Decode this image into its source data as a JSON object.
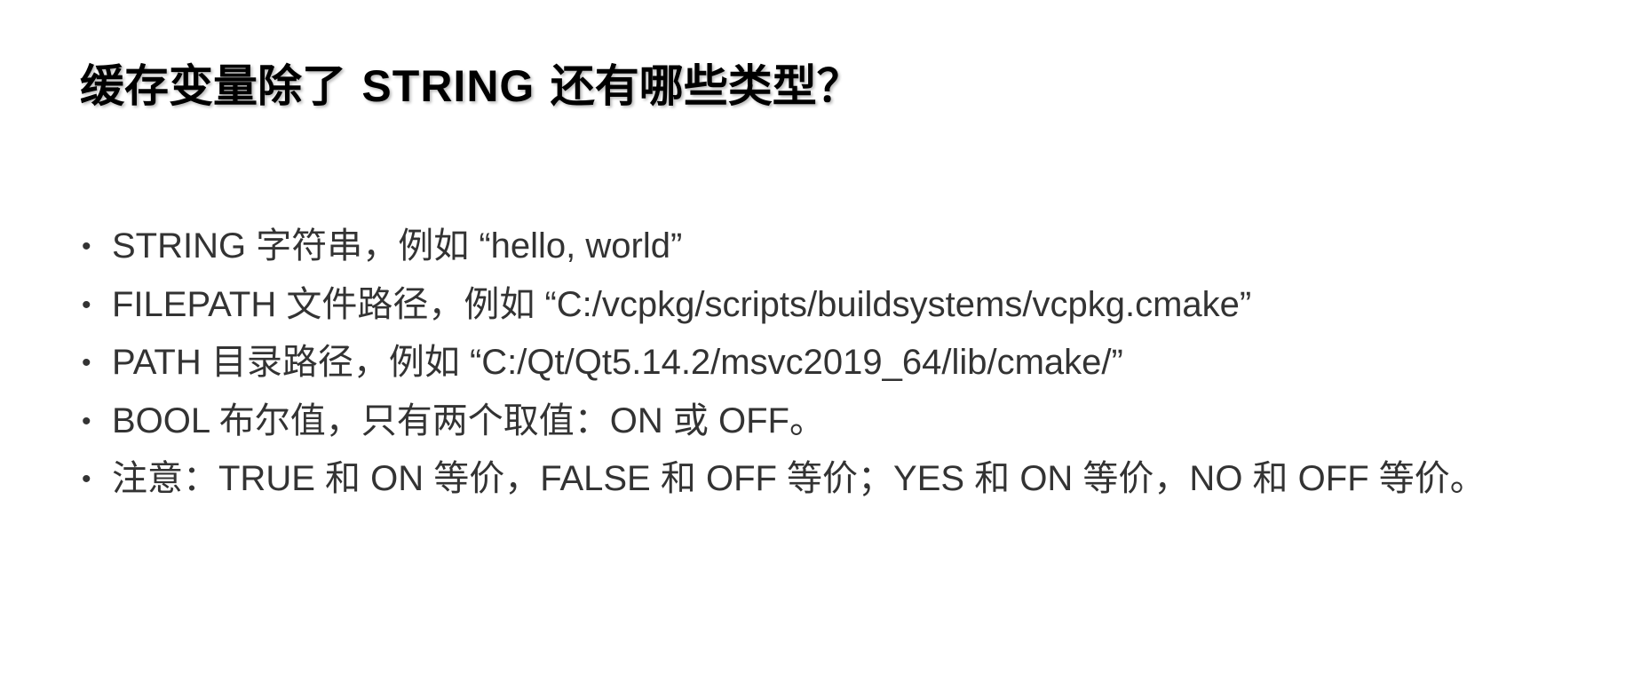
{
  "slide": {
    "title_prefix": "缓存变量除了",
    "title_keyword": "STRING",
    "title_suffix": "还有哪些类型？",
    "bullet_glyph": "•",
    "bullets": [
      "STRING 字符串，例如 “hello, world”",
      "FILEPATH 文件路径，例如 “C:/vcpkg/scripts/buildsystems/vcpkg.cmake”",
      "PATH 目录路径，例如 “C:/Qt/Qt5.14.2/msvc2019_64/lib/cmake/”",
      "BOOL 布尔值，只有两个取值：ON 或 OFF。",
      "注意：TRUE 和 ON 等价，FALSE 和 OFF 等价；YES 和 ON 等价，NO 和 OFF 等价。"
    ]
  },
  "colors": {
    "background": "#ffffff",
    "title": "#000000",
    "body_text": "#333333"
  }
}
